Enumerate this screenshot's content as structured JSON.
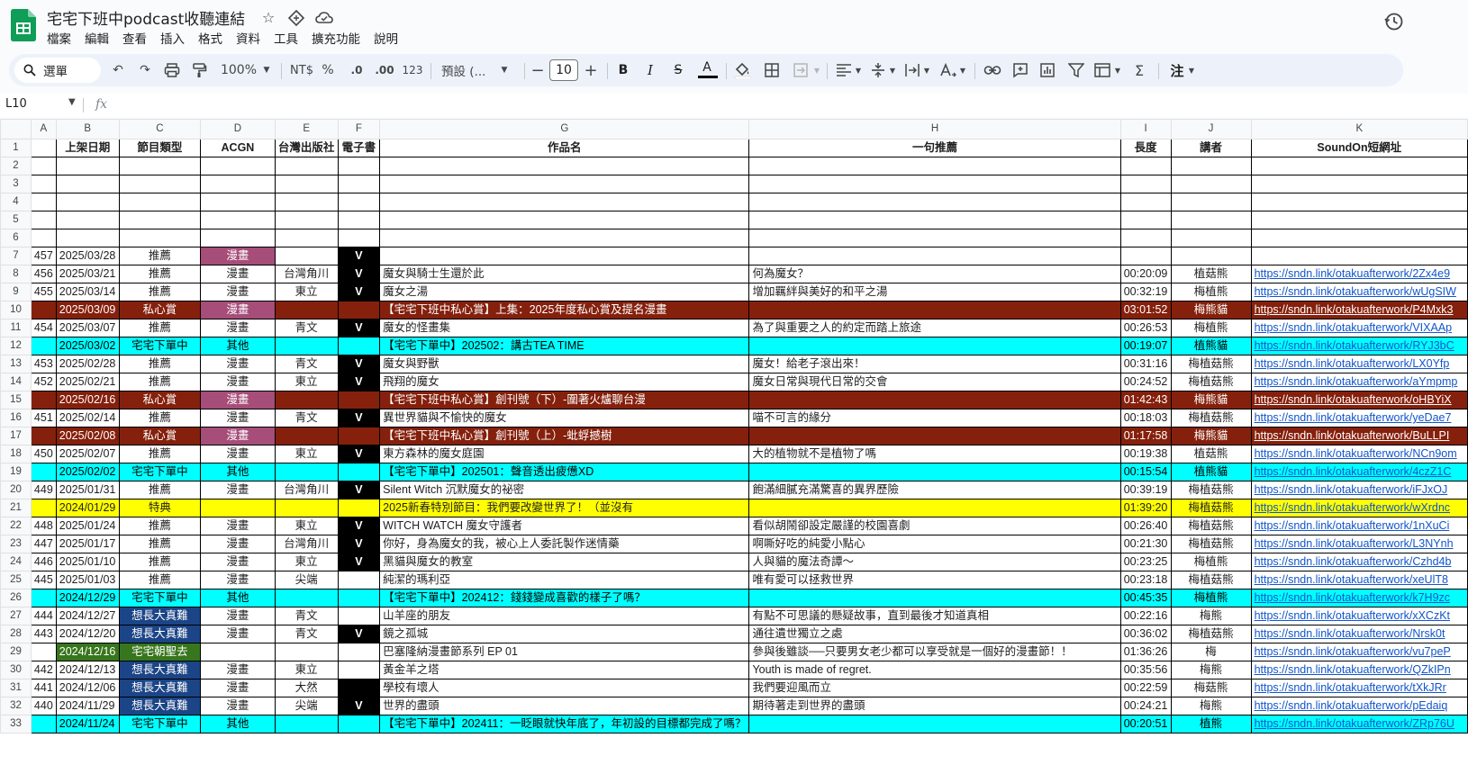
{
  "app": {
    "title": "宅宅下班中podcast收聽連結",
    "menu": [
      "檔案",
      "編輯",
      "查看",
      "插入",
      "格式",
      "資料",
      "工具",
      "擴充功能",
      "說明"
    ]
  },
  "toolbar": {
    "search_label": "選單",
    "zoom": "100%",
    "currency": "NT$",
    "percent": "%",
    "dec_decrease": ".0",
    "dec_increase": ".00",
    "format_123": "123",
    "font_name": "預設 (...",
    "font_size": "10",
    "bold": "B",
    "italic": "I",
    "strike": "S",
    "text_color": "A",
    "notes_label": "注"
  },
  "formula_bar": {
    "cell_ref": "L10",
    "fx": "fx"
  },
  "colors": {
    "private_red": "#85200c",
    "cyan": "#00ffff",
    "yellow": "#ffff00",
    "pink": "#a64d79",
    "navy": "#1c4587",
    "green": "#38761d",
    "link": "#1155cc",
    "sheets_green": "#0f9d58"
  },
  "sheet": {
    "columns": [
      "A",
      "B",
      "C",
      "D",
      "E",
      "F",
      "G",
      "H",
      "I",
      "J",
      "K"
    ],
    "selected_row": "10",
    "headers": [
      "",
      "上架日期",
      "節目類型",
      "ACGN",
      "台灣出版社",
      "電子書",
      "作品名",
      "一句推薦",
      "長度",
      "講者",
      "SoundOn短網址"
    ],
    "rows": [
      {
        "n": "2",
        "style": "blank",
        "cells": [
          "",
          "",
          "",
          "",
          "",
          "",
          "",
          "",
          "",
          "",
          ""
        ]
      },
      {
        "n": "3",
        "style": "blank",
        "cells": [
          "",
          "",
          "",
          "",
          "",
          "",
          "",
          "",
          "",
          "",
          ""
        ]
      },
      {
        "n": "4",
        "style": "blank",
        "cells": [
          "",
          "",
          "",
          "",
          "",
          "",
          "",
          "",
          "",
          "",
          ""
        ]
      },
      {
        "n": "5",
        "style": "blank",
        "cells": [
          "",
          "",
          "",
          "",
          "",
          "",
          "",
          "",
          "",
          "",
          ""
        ]
      },
      {
        "n": "6",
        "style": "blank",
        "cells": [
          "",
          "",
          "",
          "",
          "",
          "",
          "",
          "",
          "",
          "",
          ""
        ]
      },
      {
        "n": "7",
        "style": "",
        "cells": [
          "457",
          "2025/03/28",
          "推薦",
          "漫畫",
          "",
          "V",
          "",
          "",
          "",
          "",
          ""
        ],
        "pinkD": true,
        "blackF": true
      },
      {
        "n": "8",
        "style": "",
        "cells": [
          "456",
          "2025/03/21",
          "推薦",
          "漫畫",
          "台灣角川",
          "V",
          "魔女與騎士生還於此",
          "何為魔女？",
          "00:20:09",
          "植菇熊",
          "https://sndn.link/otakuafterwork/2Zx4e9"
        ],
        "blackF": true
      },
      {
        "n": "9",
        "style": "",
        "cells": [
          "455",
          "2025/03/14",
          "推薦",
          "漫畫",
          "東立",
          "V",
          "魔女之湯",
          "增加羈絆與美好的和平之湯",
          "00:32:19",
          "梅植熊",
          "https://sndn.link/otakuafterwork/wUgSIW"
        ],
        "blackF": true
      },
      {
        "n": "10",
        "style": "r-red",
        "cells": [
          "",
          "2025/03/09",
          "私心賞",
          "漫畫",
          "",
          "",
          "【宅宅下班中私心賞】上集：2025年度私心賞及提名漫畫",
          "",
          "03:01:52",
          "梅熊貓",
          "https://sndn.link/otakuafterwork/P4Mxk3"
        ],
        "pinkD": true
      },
      {
        "n": "11",
        "style": "",
        "cells": [
          "454",
          "2025/03/07",
          "推薦",
          "漫畫",
          "青文",
          "V",
          "魔女的怪畫集",
          "為了與重要之人的約定而踏上旅途",
          "00:26:53",
          "梅植熊",
          "https://sndn.link/otakuafterwork/VIXAAp"
        ],
        "blackF": true
      },
      {
        "n": "12",
        "style": "r-cyan",
        "cells": [
          "",
          "2025/03/02",
          "宅宅下單中",
          "其他",
          "",
          "",
          "【宅宅下單中】202502：講古TEA TIME",
          "",
          "00:19:07",
          "植熊貓",
          "https://sndn.link/otakuafterwork/RYJ3bC"
        ]
      },
      {
        "n": "13",
        "style": "",
        "cells": [
          "453",
          "2025/02/28",
          "推薦",
          "漫畫",
          "青文",
          "V",
          "魔女與野獸",
          "魔女！給老子滾出來！",
          "00:31:16",
          "梅植菇熊",
          "https://sndn.link/otakuafterwork/LX0Yfp"
        ],
        "blackF": true
      },
      {
        "n": "14",
        "style": "",
        "cells": [
          "452",
          "2025/02/21",
          "推薦",
          "漫畫",
          "東立",
          "V",
          "飛翔的魔女",
          "魔女日常與現代日常的交會",
          "00:24:52",
          "梅植菇熊",
          "https://sndn.link/otakuafterwork/aYmpmp"
        ],
        "blackF": true
      },
      {
        "n": "15",
        "style": "r-red",
        "cells": [
          "",
          "2025/02/16",
          "私心賞",
          "漫畫",
          "",
          "",
          "【宅宅下班中私心賞】創刊號（下）-圍著火爐聊台漫",
          "",
          "01:42:43",
          "梅熊貓",
          "https://sndn.link/otakuafterwork/oHBYiX"
        ],
        "pinkD": true
      },
      {
        "n": "16",
        "style": "",
        "cells": [
          "451",
          "2025/02/14",
          "推薦",
          "漫畫",
          "青文",
          "V",
          "異世界貓與不愉快的魔女",
          "喵不可言的緣分",
          "00:18:03",
          "梅植菇熊",
          "https://sndn.link/otakuafterwork/yeDae7"
        ],
        "blackF": true
      },
      {
        "n": "17",
        "style": "r-red",
        "cells": [
          "",
          "2025/02/08",
          "私心賞",
          "漫畫",
          "",
          "",
          "【宅宅下班中私心賞】創刊號（上）-蚍蜉撼樹",
          "",
          "01:17:58",
          "梅熊貓",
          "https://sndn.link/otakuafterwork/BuLLPI"
        ],
        "pinkD": true
      },
      {
        "n": "18",
        "style": "",
        "cells": [
          "450",
          "2025/02/07",
          "推薦",
          "漫畫",
          "東立",
          "V",
          "東方森林的魔女庭園",
          "大的植物就不是植物了嗎",
          "00:19:38",
          "植菇熊",
          "https://sndn.link/otakuafterwork/NCn9om"
        ],
        "blackF": true
      },
      {
        "n": "19",
        "style": "r-cyan",
        "cells": [
          "",
          "2025/02/02",
          "宅宅下單中",
          "其他",
          "",
          "",
          "【宅宅下單中】202501：聲音透出疲憊XD",
          "",
          "00:15:54",
          "植熊貓",
          "https://sndn.link/otakuafterwork/4czZ1C"
        ]
      },
      {
        "n": "20",
        "style": "",
        "cells": [
          "449",
          "2025/01/31",
          "推薦",
          "漫畫",
          "台灣角川",
          "V",
          "Silent Witch 沉默魔女的祕密",
          "飽滿細膩充滿驚喜的異界歷險",
          "00:39:19",
          "梅植菇熊",
          "https://sndn.link/otakuafterwork/iFJxOJ"
        ],
        "blackF": true
      },
      {
        "n": "21",
        "style": "r-yellow",
        "cells": [
          "",
          "2024/01/29",
          "特典",
          "",
          "",
          "",
          "2025新春特別節目：我們要改變世界了！（並沒有",
          "",
          "01:39:20",
          "梅植菇熊",
          "https://sndn.link/otakuafterwork/wXrdnc"
        ]
      },
      {
        "n": "22",
        "style": "",
        "cells": [
          "448",
          "2025/01/24",
          "推薦",
          "漫畫",
          "東立",
          "V",
          "WITCH WATCH 魔女守護者",
          "看似胡鬧卻設定嚴謹的校園喜劇",
          "00:26:40",
          "梅植菇熊",
          "https://sndn.link/otakuafterwork/1nXuCi"
        ],
        "blackF": true
      },
      {
        "n": "23",
        "style": "",
        "cells": [
          "447",
          "2025/01/17",
          "推薦",
          "漫畫",
          "台灣角川",
          "V",
          "你好，身為魔女的我，被心上人委託製作迷情藥",
          "啊嘶好吃的純愛小點心",
          "00:21:30",
          "梅植菇熊",
          "https://sndn.link/otakuafterwork/L3NYnh"
        ],
        "blackF": true
      },
      {
        "n": "24",
        "style": "",
        "cells": [
          "446",
          "2025/01/10",
          "推薦",
          "漫畫",
          "東立",
          "V",
          "黑貓與魔女的教室",
          "人與貓的魔法奇譚～",
          "00:23:25",
          "梅植熊",
          "https://sndn.link/otakuafterwork/Czhd4b"
        ],
        "blackF": true
      },
      {
        "n": "25",
        "style": "",
        "cells": [
          "445",
          "2025/01/03",
          "推薦",
          "漫畫",
          "尖端",
          "",
          "純潔的瑪利亞",
          "唯有愛可以拯救世界",
          "00:23:18",
          "梅植菇熊",
          "https://sndn.link/otakuafterwork/xeUlT8"
        ]
      },
      {
        "n": "26",
        "style": "r-cyan",
        "cells": [
          "",
          "2024/12/29",
          "宅宅下單中",
          "其他",
          "",
          "",
          "【宅宅下單中】202412：錢錢變成喜歡的樣子了嗎？",
          "",
          "00:45:35",
          "梅植熊",
          "https://sndn.link/otakuafterwork/k7H9zc"
        ]
      },
      {
        "n": "27",
        "style": "",
        "cells": [
          "444",
          "2024/12/27",
          "想長大真難",
          "漫畫",
          "青文",
          "",
          "山羊座的朋友",
          "有點不可思議的懸疑故事，直到最後才知道真相",
          "00:22:16",
          "梅熊",
          "https://sndn.link/otakuafterwork/xXCzKt"
        ],
        "navyC": true
      },
      {
        "n": "28",
        "style": "",
        "cells": [
          "443",
          "2024/12/20",
          "想長大真難",
          "漫畫",
          "青文",
          "V",
          "鏡之孤城",
          "通往遺世獨立之處",
          "00:36:02",
          "梅植菇熊",
          "https://sndn.link/otakuafterwork/Nrsk0t"
        ],
        "navyC": true,
        "blackF": true
      },
      {
        "n": "29",
        "style": "",
        "cells": [
          "",
          "2024/12/16",
          "宅宅朝聖去",
          "",
          "",
          "",
          "巴塞隆納漫畫節系列 EP 01",
          "參與後雖談──只要男女老少都可以享受就是一個好的漫畫節！！",
          "01:36:26",
          "梅",
          "https://sndn.link/otakuafterwork/vu7peP"
        ],
        "greenBC": true
      },
      {
        "n": "30",
        "style": "",
        "cells": [
          "442",
          "2024/12/13",
          "想長大真難",
          "漫畫",
          "東立",
          "",
          "黃金羊之塔",
          "Youth is made of regret.",
          "00:35:56",
          "梅熊",
          "https://sndn.link/otakuafterwork/QZkIPn"
        ],
        "navyC": true
      },
      {
        "n": "31",
        "style": "",
        "cells": [
          "441",
          "2024/12/06",
          "想長大真難",
          "漫畫",
          "大然",
          "",
          "學校有壞人",
          "我們要迎風而立",
          "00:22:59",
          "梅菇熊",
          "https://sndn.link/otakuafterwork/tXkJRr"
        ],
        "navyC": true,
        "blackF": true
      },
      {
        "n": "32",
        "style": "",
        "cells": [
          "440",
          "2024/11/29",
          "想長大真難",
          "漫畫",
          "尖端",
          "V",
          "世界的盡頭",
          "期待著走到世界的盡頭",
          "00:24:21",
          "梅熊",
          "https://sndn.link/otakuafterwork/pEdaiq"
        ],
        "navyC": true,
        "blackF": true
      },
      {
        "n": "33",
        "style": "r-cyan",
        "cells": [
          "",
          "2024/11/24",
          "宅宅下單中",
          "其他",
          "",
          "",
          "【宅宅下單中】202411：一眨眼就快年底了，年初設的目標都完成了嗎？",
          "",
          "00:20:51",
          "植熊",
          "https://sndn.link/otakuafterwork/ZRp76U"
        ]
      }
    ]
  }
}
